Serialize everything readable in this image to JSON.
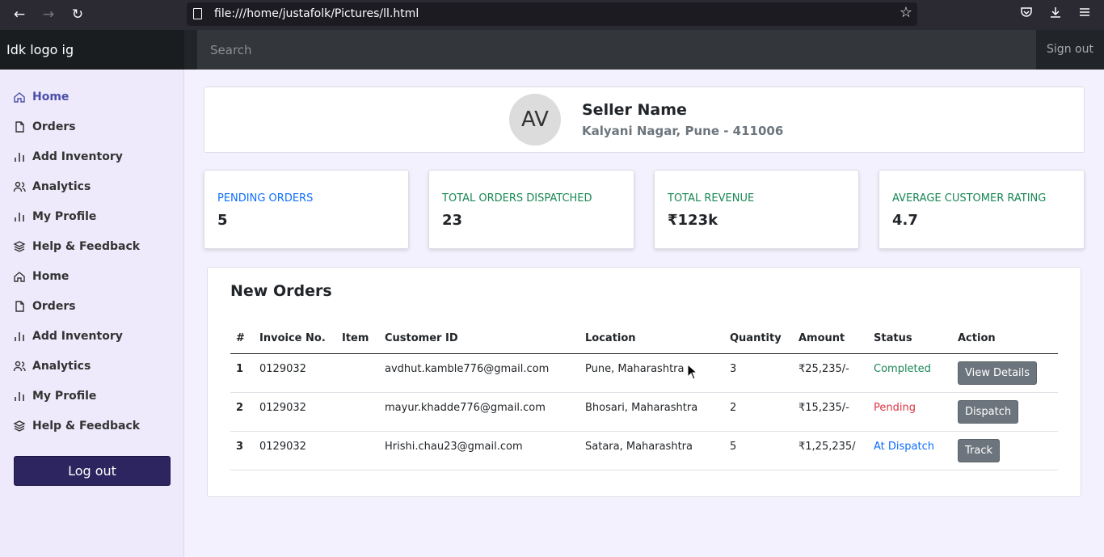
{
  "browser": {
    "url": "file:///home/justafolk/Pictures/ll.html"
  },
  "header": {
    "brand": "Idk logo ig",
    "search_placeholder": "Search",
    "signout_label": "Sign out"
  },
  "sidebar": {
    "items": [
      {
        "label": "Home",
        "icon": "home-icon"
      },
      {
        "label": "Orders",
        "icon": "file-icon"
      },
      {
        "label": "Add Inventory",
        "icon": "bar-chart-icon"
      },
      {
        "label": "Analytics",
        "icon": "users-icon"
      },
      {
        "label": "My Profile",
        "icon": "bar-chart-icon"
      },
      {
        "label": "Help & Feedback",
        "icon": "layers-icon"
      },
      {
        "label": "Home",
        "icon": "home-icon"
      },
      {
        "label": "Orders",
        "icon": "file-icon"
      },
      {
        "label": "Add Inventory",
        "icon": "bar-chart-icon"
      },
      {
        "label": "Analytics",
        "icon": "users-icon"
      },
      {
        "label": "My Profile",
        "icon": "bar-chart-icon"
      },
      {
        "label": "Help & Feedback",
        "icon": "layers-icon"
      }
    ],
    "logout_label": "Log out"
  },
  "profile": {
    "initials": "AV",
    "name": "Seller Name",
    "address": "Kalyani Nagar, Pune - 411006"
  },
  "stats": [
    {
      "label": "PENDING ORDERS",
      "value": "5",
      "color": "#0d6efd"
    },
    {
      "label": "TOTAL ORDERS DISPATCHED",
      "value": "23",
      "color": "#198754"
    },
    {
      "label": "TOTAL REVENUE",
      "value": "₹123k",
      "color": "#198754"
    },
    {
      "label": "AVERAGE CUSTOMER RATING",
      "value": "4.7",
      "color": "#198754"
    }
  ],
  "orders": {
    "title": "New Orders",
    "columns": [
      "#",
      "Invoice No.",
      "Item",
      "Customer ID",
      "Location",
      "Quantity",
      "Amount",
      "Status",
      "Action"
    ],
    "rows": [
      {
        "idx": "1",
        "invoice": "0129032",
        "item": "",
        "customer": "avdhut.kamble776@gmail.com",
        "location": "Pune, Maharashtra",
        "quantity": "3",
        "amount": "₹25,235/-",
        "status": "Completed",
        "status_color": "#198754",
        "action": "View Details"
      },
      {
        "idx": "2",
        "invoice": "0129032",
        "item": "",
        "customer": "mayur.khadde776@gmail.com",
        "location": "Bhosari, Maharashtra",
        "quantity": "2",
        "amount": "₹15,235/-",
        "status": "Pending",
        "status_color": "#dc3545",
        "action": "Dispatch"
      },
      {
        "idx": "3",
        "invoice": "0129032",
        "item": "",
        "customer": "Hrishi.chau23@gmail.com",
        "location": "Satara, Maharashtra",
        "quantity": "5",
        "amount": "₹1,25,235/",
        "status": "At Dispatch",
        "status_color": "#0d6efd",
        "action": "Track"
      }
    ]
  },
  "colors": {
    "sidebar_active": "#4a4ea8",
    "logout_bg": "#2c2560"
  }
}
